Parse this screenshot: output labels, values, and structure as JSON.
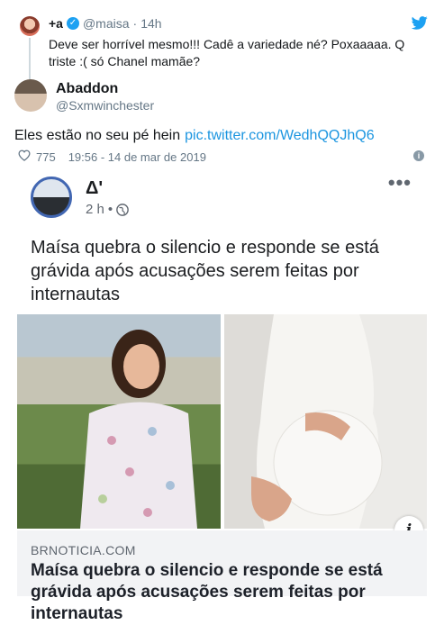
{
  "reply_tweet": {
    "name": "+a",
    "handle": "@maisa",
    "separator": "·",
    "time": "14h",
    "text": "Deve ser horrível mesmo!!! Cadê a variedade né? Poxaaaaa. Q triste :( só Chanel mamãe?"
  },
  "main_tweet": {
    "name": "Abaddon",
    "handle": "@Sxmwinchester",
    "text": "Eles estão no seu pé hein",
    "link": "pic.twitter.com/WedhQQJhQ6",
    "likes": "775",
    "timestamp": "19:56 - 14 de mar de 2019"
  },
  "embedded_post": {
    "page_name": "Δ'",
    "time": "2 h",
    "bullet": "•",
    "more": "•••",
    "headline": "Maísa quebra o silencio e responde se está grávida após acusações serem feitas por internautas",
    "info_badge": "i",
    "link_domain": "BRNOTICIA.COM",
    "link_title": "Maísa quebra o silencio e responde se está grávida após acusações serem feitas por internautas"
  },
  "colors": {
    "twitter_blue": "#1da1f2",
    "link_blue": "#1b95e0",
    "facebook_blue": "#4267b2",
    "muted_gray": "#657786"
  },
  "icons": [
    "verified-icon",
    "twitter-bird-icon",
    "heart-icon",
    "info-icon",
    "globe-icon",
    "more-options-icon"
  ]
}
